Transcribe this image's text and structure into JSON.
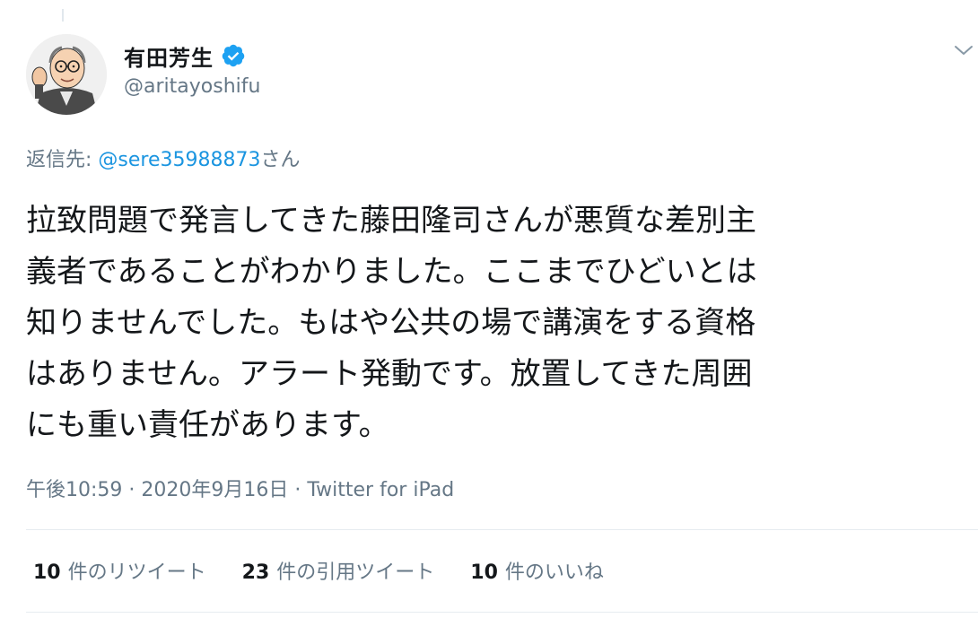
{
  "author": {
    "display_name": "有田芳生",
    "handle": "@aritayoshifu",
    "verified": true
  },
  "reply": {
    "prefix": "返信先: ",
    "target": "@sere35988873",
    "suffix": "さん"
  },
  "tweet": {
    "lines": [
      "拉致問題で発言してきた藤田隆司さんが悪質な差別主",
      "義者であることがわかりました。ここまでひどいとは",
      "知りませんでした。もはや公共の場で講演をする資格",
      "はありません。アラート発動です。放置してきた周囲",
      "にも重い責任があります。"
    ]
  },
  "meta": {
    "time": "午後10:59",
    "separator": " · ",
    "date": "2020年9月16日",
    "separator2": " · ",
    "source": "Twitter for iPad"
  },
  "stats": [
    {
      "count": "10",
      "label": "件のリツイート"
    },
    {
      "count": "23",
      "label": "件の引用ツイート"
    },
    {
      "count": "10",
      "label": "件のいいね"
    }
  ],
  "colors": {
    "text": "#14171a",
    "secondary": "#657786",
    "link": "#1b95e0",
    "verified": "#1da1f2",
    "divider": "#e6ecf0"
  },
  "icons": {
    "verified": "verified-badge-icon",
    "menu": "chevron-down-icon"
  }
}
